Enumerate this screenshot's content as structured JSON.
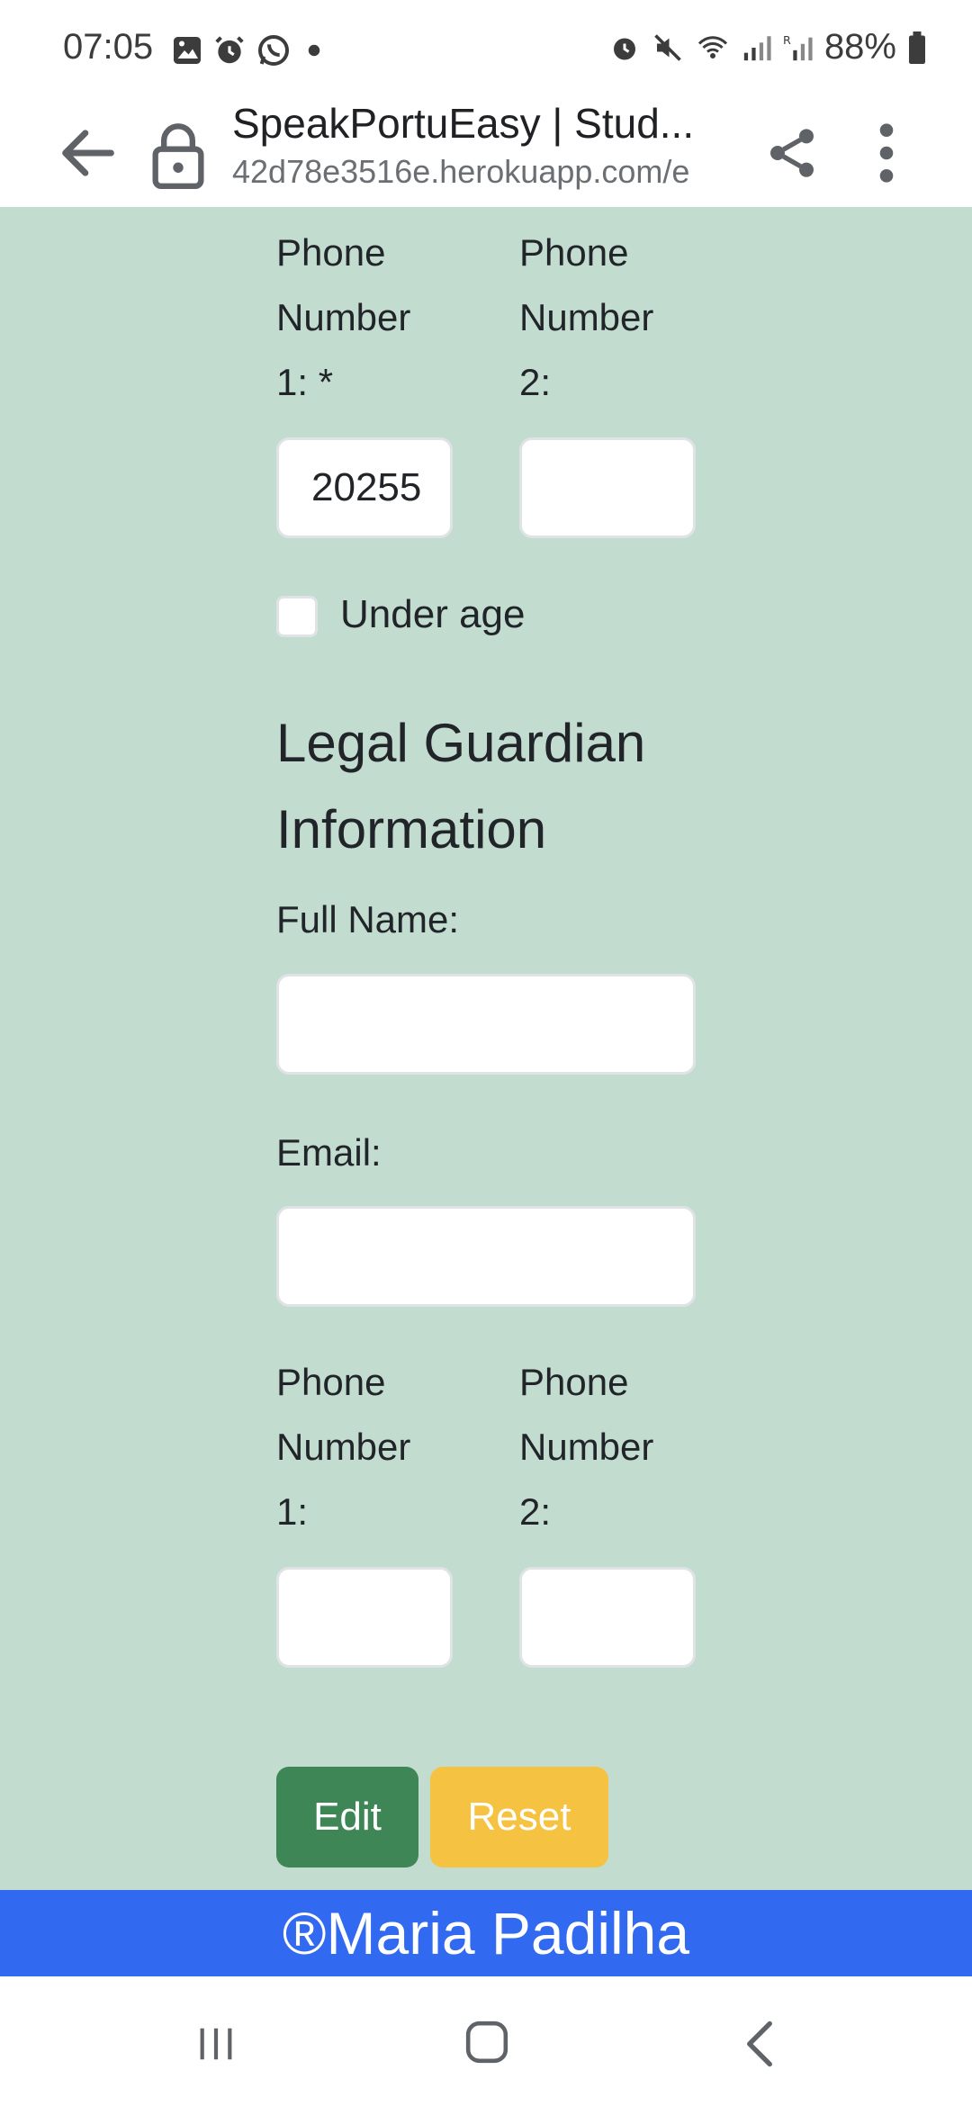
{
  "status_bar": {
    "time": "07:05",
    "battery": "88%",
    "left_icons": [
      "gallery-icon",
      "alarm-icon",
      "whatsapp-icon",
      "dot-icon"
    ],
    "right_icons": [
      "alarm-icon",
      "mute-icon",
      "wifi-icon",
      "signal-icon",
      "signal-r-icon",
      "battery-icon"
    ]
  },
  "browser": {
    "title": "SpeakPortuEasy | Stud...",
    "url": "42d78e3516e.herokuapp.com/e"
  },
  "form": {
    "student_phone1_label": "Phone Number 1: *",
    "student_phone1_value": "20255",
    "student_phone2_label": "Phone Number 2:",
    "student_phone2_value": "",
    "under_age_label": "Under age",
    "under_age_checked": false,
    "guardian_section_title": "Legal Guardian Information",
    "guardian_full_name_label": "Full Name:",
    "guardian_full_name_value": "",
    "guardian_email_label": "Email:",
    "guardian_email_value": "",
    "guardian_phone1_label": "Phone Number 1:",
    "guardian_phone1_value": "",
    "guardian_phone2_label": "Phone Number 2:",
    "guardian_phone2_value": ""
  },
  "buttons": {
    "edit_label": "Edit",
    "reset_label": "Reset"
  },
  "footer": {
    "text": "®Maria Padilha"
  },
  "colors": {
    "page_bg": "#c3dcd0",
    "edit_button": "#3e8656",
    "reset_button": "#f5c242",
    "footer_bg": "#3169f0"
  }
}
